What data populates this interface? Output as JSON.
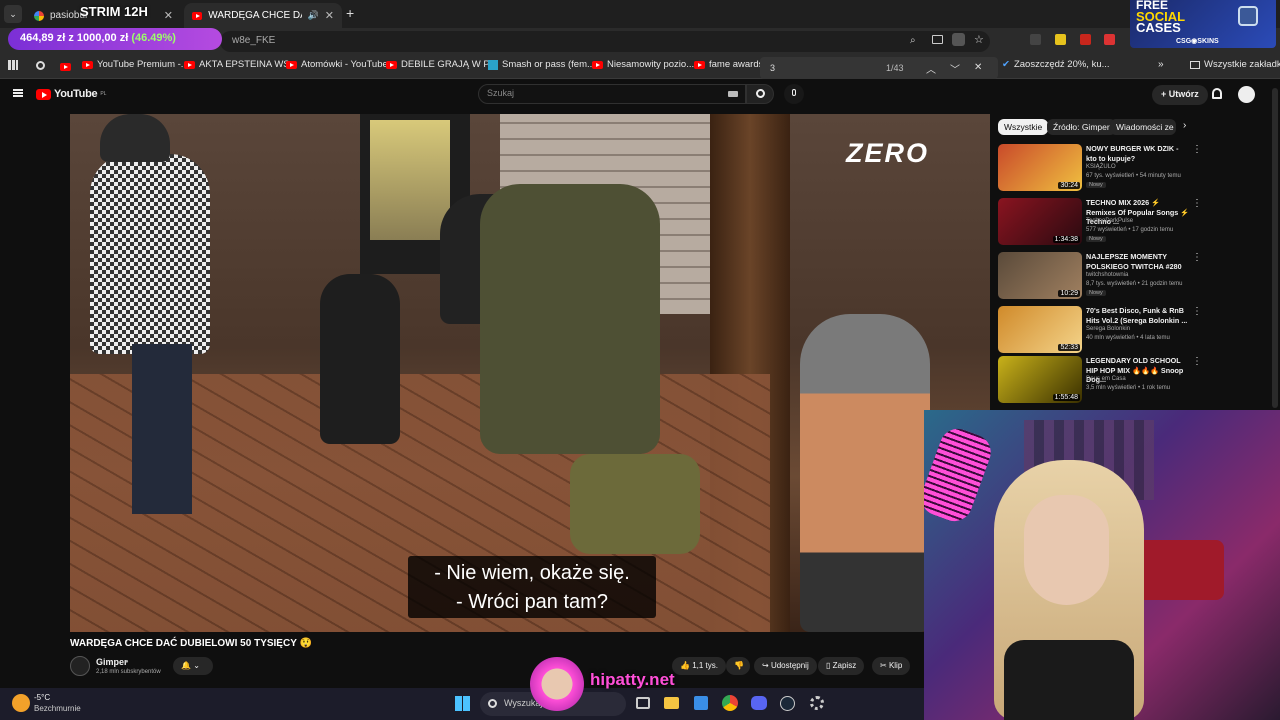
{
  "overlay": {
    "strim": "STRIM 12H",
    "goal": {
      "current": "464,89 zł",
      "sep": "z",
      "target": "1000,00 zł",
      "pct": "(46.49%)"
    },
    "promo": {
      "line1": "FREE",
      "line2": "SOCIAL",
      "line3": "CASES",
      "brand": "CSG◉SKINS"
    },
    "watermark": "hipatty.net"
  },
  "browser": {
    "tabs": [
      {
        "label": "pasiobur",
        "active": false
      },
      {
        "label": "WARDĘGA CHCE DAĆ DUBI",
        "active": true
      }
    ],
    "url": "w8e_FKE",
    "bookmarks": [
      {
        "label": "YouTube Premium -..."
      },
      {
        "label": "AKTA EPSTEINA WS..."
      },
      {
        "label": "Atomówki - YouTube"
      },
      {
        "label": "DEBILE GRAJĄ W P..."
      },
      {
        "label": "Smash or pass (fem..."
      },
      {
        "label": "Niesamowity pozio..."
      },
      {
        "label": "fame awards -"
      },
      {
        "label": "Zaoszczędź 20%, ku..."
      }
    ],
    "all_bookmarks": "Wszystkie zakładki",
    "find": {
      "query": "3",
      "count": "1/43"
    }
  },
  "youtube": {
    "logo": "YouTube",
    "logo_region": "PL",
    "search_placeholder": "Szukaj",
    "create_label": "Utwórz",
    "video": {
      "channel_logo": "ZERO",
      "subtitle_line1": "- Nie wiem, okaże się.",
      "subtitle_line2": "- Wróci pan tam?",
      "title": "WARDĘGA CHCE DAĆ DUBIELOWI 50 TYSIĘCY 😲",
      "channel": "Gimper",
      "subscribers": "2,18 mln subskrybentów",
      "likes": "1,1 tys.",
      "share": "Udostępnij",
      "save": "Zapisz",
      "clip": "Klip"
    },
    "chips": [
      "Wszystkie",
      "Źródło: Gimper",
      "Wiadomości ze ś"
    ],
    "recommendations": [
      {
        "title": "NOWY BURGER WK DZIK - kto to kupuje?",
        "channel": "KSIĄŻULO",
        "meta": "67 tys. wyświetleń • 54 minuty temu",
        "duration": "30:24",
        "badge": "Nowy",
        "color": "#c94a2a"
      },
      {
        "title": "TECHNO MIX 2026 ⚡ Remixes Of Popular Songs ⚡ Techno ...",
        "channel": "TechnoDarkPulse",
        "meta": "577 wyświetleń • 17 godzin temu",
        "duration": "1:34:38",
        "badge": "Nowy",
        "color": "#8a1420"
      },
      {
        "title": "NAJLEPSZE MOMENTY POLSKIEGO TWITCHA #280",
        "channel": "twitchshotownia",
        "meta": "8,7 tys. wyświetleń • 21 godzin temu",
        "duration": "10:29",
        "badge": "Nowy",
        "color": "#5a4a3a"
      },
      {
        "title": "70's Best Disco, Funk & RnB Hits Vol.2 (Serega Bolonkin ...",
        "channel": "Serega Bolonkin",
        "meta": "40 mln wyświetleń • 4 lata temu",
        "duration": "52:33",
        "badge": "",
        "color": "#d08a2a"
      },
      {
        "title": "LEGENDARY OLD SCHOOL HIP HOP MIX 🔥🔥🔥 Snoop Dog...",
        "channel": "Deus em Casa",
        "meta": "3,5 mln wyświetleń • 1 rok temu",
        "duration": "1:55:48",
        "badge": "",
        "color": "#c9b21a"
      }
    ]
  },
  "taskbar": {
    "weather_temp": "-5°C",
    "weather_desc": "Bezchmurnie",
    "search_placeholder": "Wyszukaj"
  }
}
